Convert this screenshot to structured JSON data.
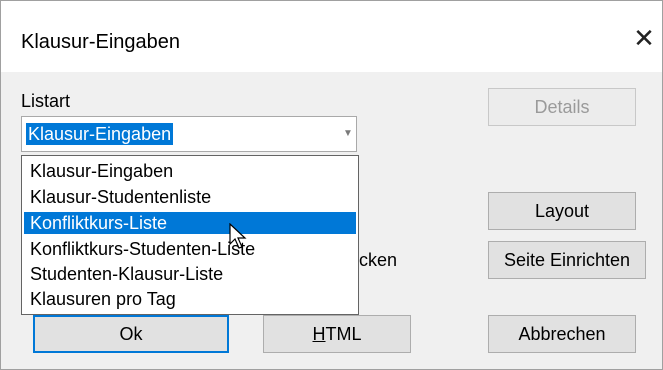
{
  "window": {
    "title": "Klausur-Eingaben",
    "close_glyph": "✕"
  },
  "listart": {
    "label": "Listart",
    "selected": "Klausur-Eingaben",
    "options": [
      "Klausur-Eingaben",
      "Klausur-Studentenliste",
      "Konfliktkurs-Liste",
      "Konfliktkurs-Studenten-Liste",
      "Studenten-Klausur-Liste",
      "Klausuren pro Tag"
    ],
    "highlighted_index": 2
  },
  "partial_text": "cken",
  "buttons": {
    "details": "Details",
    "layout": "Layout",
    "seite_einrichten": "Seite Einrichten",
    "ok": "Ok",
    "html_prefix": "",
    "html_underlined": "H",
    "html_rest": "TML",
    "abbrechen": "Abbrechen"
  },
  "colors": {
    "selection": "#0078d7",
    "dialog_bg": "#f0f0f0"
  }
}
